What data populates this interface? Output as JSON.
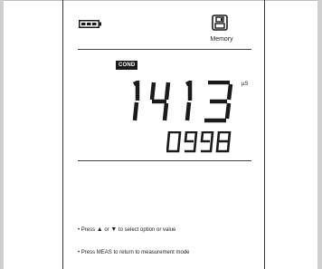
{
  "window": {
    "frame": "instrument-display"
  },
  "status": {
    "battery_icon": "battery-full-icon",
    "memory_icon": "memory-save-icon",
    "memory_label": "Memory"
  },
  "measurement": {
    "mode_badge": "COND",
    "main_value": "1413",
    "unit": "µS",
    "secondary_value": "0998"
  },
  "instructions": {
    "line1_prefix": "• Press ",
    "line1_up": "▲",
    "line1_or": " or ",
    "line1_down": "▼",
    "line1_suffix": " to select option or value",
    "line2": "• Press MEAS to return to measurement mode"
  },
  "colors": {
    "frame_gray": "#cfcfcf",
    "ink": "#1a1a1a",
    "background": "#ffffff"
  }
}
